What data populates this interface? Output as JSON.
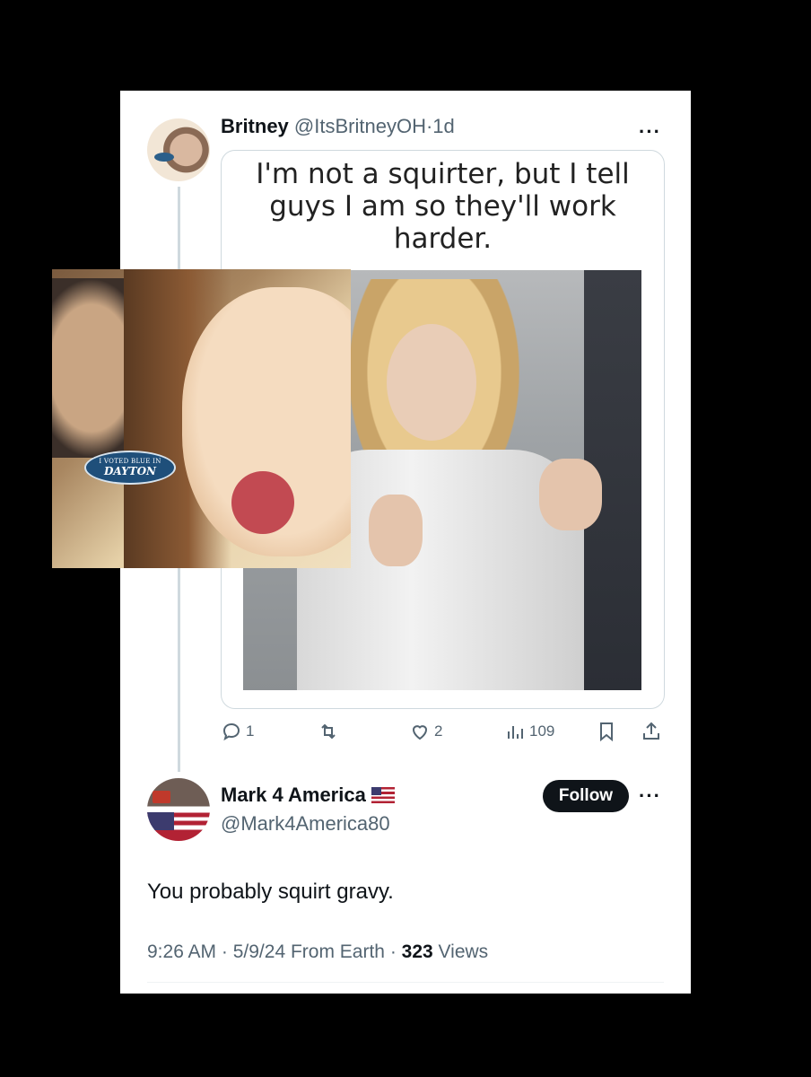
{
  "tweet": {
    "author_name": "Britney",
    "handle": "@ItsBritneyOH",
    "separator": "·",
    "time": "1d",
    "more": "···",
    "meme_text": "I'm not a squirter, but I tell guys I am so they'll work harder.",
    "actions": {
      "replies": "1",
      "retweets": "",
      "likes": "2",
      "views": "109"
    }
  },
  "reply": {
    "author_name": "Mark 4 America",
    "handle": "@Mark4America80",
    "follow_label": "Follow",
    "more": "···",
    "text": "You probably squirt gravy.",
    "meta_time": "9:26 AM",
    "meta_sep1": " · ",
    "meta_date": "5/9/24",
    "meta_source": " From Earth",
    "meta_sep2": " · ",
    "meta_views": "323",
    "meta_views_label": " Views"
  },
  "overlay": {
    "badge_line1": "I VOTED BLUE IN",
    "badge_line2": "DAYTON"
  }
}
